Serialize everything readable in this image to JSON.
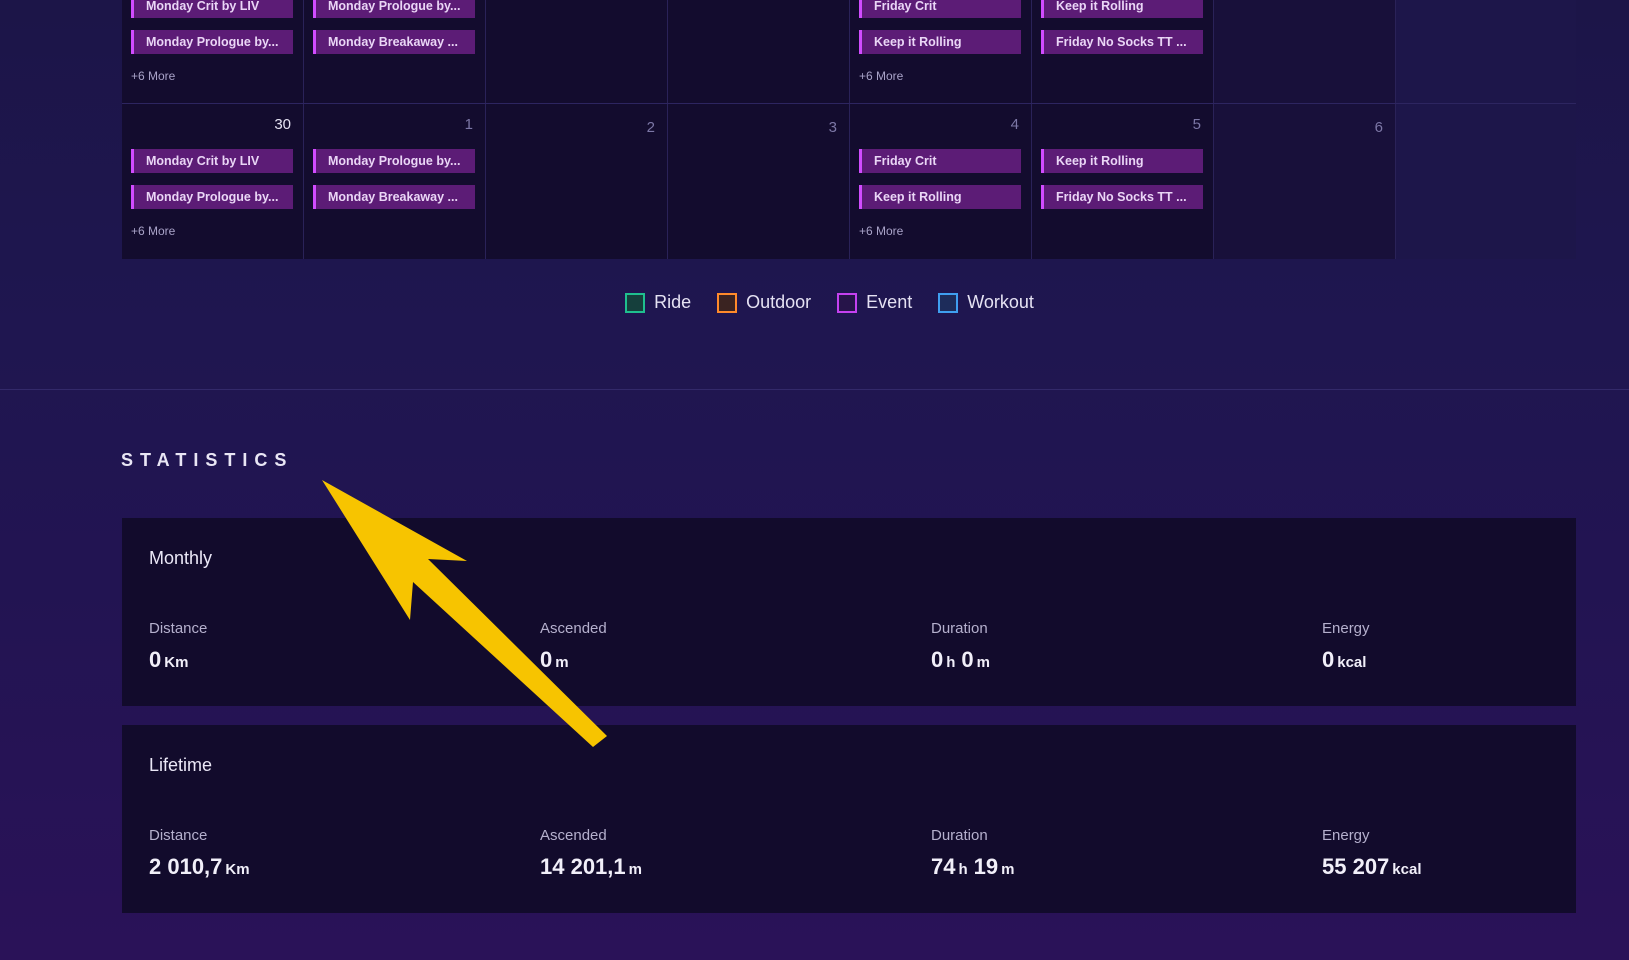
{
  "calendar": {
    "weeks": [
      {
        "days": [
          {
            "num": "",
            "events": [
              "Monday Crit by LIV",
              "Monday Prologue by..."
            ],
            "more": "+6 More"
          },
          {
            "num": "",
            "events": [
              "Monday Prologue by...",
              "Monday Breakaway ..."
            ],
            "more": ""
          },
          {
            "num": "",
            "events": [],
            "more": ""
          },
          {
            "num": "",
            "events": [],
            "more": ""
          },
          {
            "num": "",
            "events": [
              "Friday Crit",
              "Keep it Rolling"
            ],
            "more": "+6 More"
          },
          {
            "num": "",
            "events": [
              "Keep it Rolling",
              "Friday No Socks TT ..."
            ],
            "more": ""
          },
          {
            "num": "",
            "events": [],
            "more": ""
          }
        ]
      },
      {
        "days": [
          {
            "num": "30",
            "events": [
              "Monday Crit by LIV",
              "Monday Prologue by..."
            ],
            "more": "+6 More"
          },
          {
            "num": "1",
            "events": [
              "Monday Prologue by...",
              "Monday Breakaway ..."
            ],
            "more": ""
          },
          {
            "num": "2",
            "events": [],
            "more": ""
          },
          {
            "num": "3",
            "events": [],
            "more": ""
          },
          {
            "num": "4",
            "events": [
              "Friday Crit",
              "Keep it Rolling"
            ],
            "more": "+6 More"
          },
          {
            "num": "5",
            "events": [
              "Keep it Rolling",
              "Friday No Socks TT ..."
            ],
            "more": ""
          },
          {
            "num": "6",
            "events": [],
            "more": ""
          }
        ]
      }
    ]
  },
  "legend": [
    {
      "label": "Ride",
      "color": "#1fbf8f"
    },
    {
      "label": "Outdoor",
      "color": "#ff8a2b"
    },
    {
      "label": "Event",
      "color": "#c441f0"
    },
    {
      "label": "Workout",
      "color": "#3f9ff0"
    }
  ],
  "statistics": {
    "title": "STATISTICS",
    "monthly": {
      "title": "Monthly",
      "distance": {
        "label": "Distance",
        "value": "0",
        "unit": "Km"
      },
      "ascended": {
        "label": "Ascended",
        "value": "0",
        "unit": "m"
      },
      "duration": {
        "label": "Duration",
        "hours": "0",
        "h_unit": "h",
        "minutes": "0",
        "m_unit": "m"
      },
      "energy": {
        "label": "Energy",
        "value": "0",
        "unit": "kcal"
      }
    },
    "lifetime": {
      "title": "Lifetime",
      "distance": {
        "label": "Distance",
        "value": "2 010,7",
        "unit": "Km"
      },
      "ascended": {
        "label": "Ascended",
        "value": "14 201,1",
        "unit": "m"
      },
      "duration": {
        "label": "Duration",
        "hours": "74",
        "h_unit": "h",
        "minutes": "19",
        "m_unit": "m"
      },
      "energy": {
        "label": "Energy",
        "value": "55 207",
        "unit": "kcal"
      }
    }
  },
  "annotation": {
    "color": "#f7c400"
  }
}
